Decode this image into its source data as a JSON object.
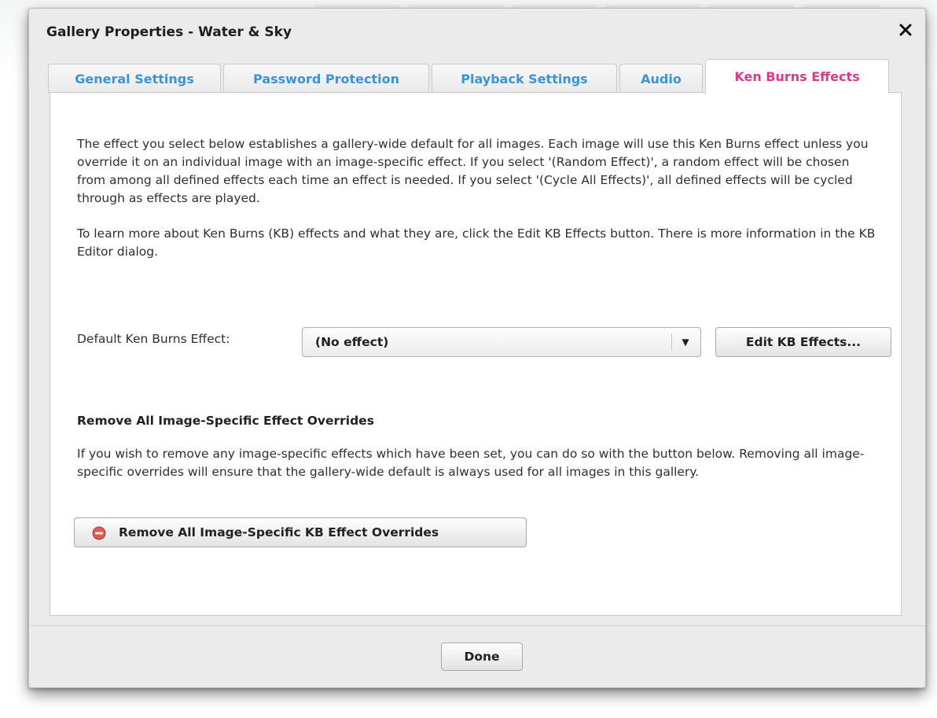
{
  "dialog": {
    "title": "Gallery Properties - Water & Sky",
    "close_label": "×"
  },
  "tabs": [
    {
      "label": "General Settings",
      "active": false
    },
    {
      "label": "Password Protection",
      "active": false
    },
    {
      "label": "Playback Settings",
      "active": false
    },
    {
      "label": "Audio",
      "active": false
    },
    {
      "label": "Ken Burns Effects",
      "active": true
    }
  ],
  "ken_burns": {
    "intro_text": "The effect you select below establishes a gallery-wide default for all images.  Each image will use this Ken Burns effect unless you override it on an individual image with an image-specific effect.  If you select '(Random Effect)', a random effect will be chosen from among all defined effects each time an effect is needed.  If you select '(Cycle All Effects)', all defined effects will be cycled through as effects are played.",
    "learn_text": "To learn more about Ken Burns (KB) effects and what they are, click the Edit KB Effects button. There is more information in the KB Editor dialog.",
    "default_label": "Default Ken Burns Effect:",
    "default_value": "(No effect)",
    "edit_button": "Edit KB Effects...",
    "remove_heading": "Remove All Image-Specific Effect Overrides",
    "remove_text": "If you wish to remove any image-specific effects which have been set, you can do so with the button below.  Removing all image-specific overrides will ensure that the gallery-wide default is always used for all images in this gallery.",
    "remove_button": "Remove All Image-Specific KB Effect Overrides"
  },
  "footer": {
    "done_button": "Done"
  },
  "colors": {
    "tab_text": "#3a94d8",
    "tab_active_text": "#e0368b",
    "remove_icon": "#e05a50"
  },
  "icons": {
    "close": "close-icon",
    "dropdown": "chevron-down-icon",
    "remove": "minus-circle-icon"
  }
}
